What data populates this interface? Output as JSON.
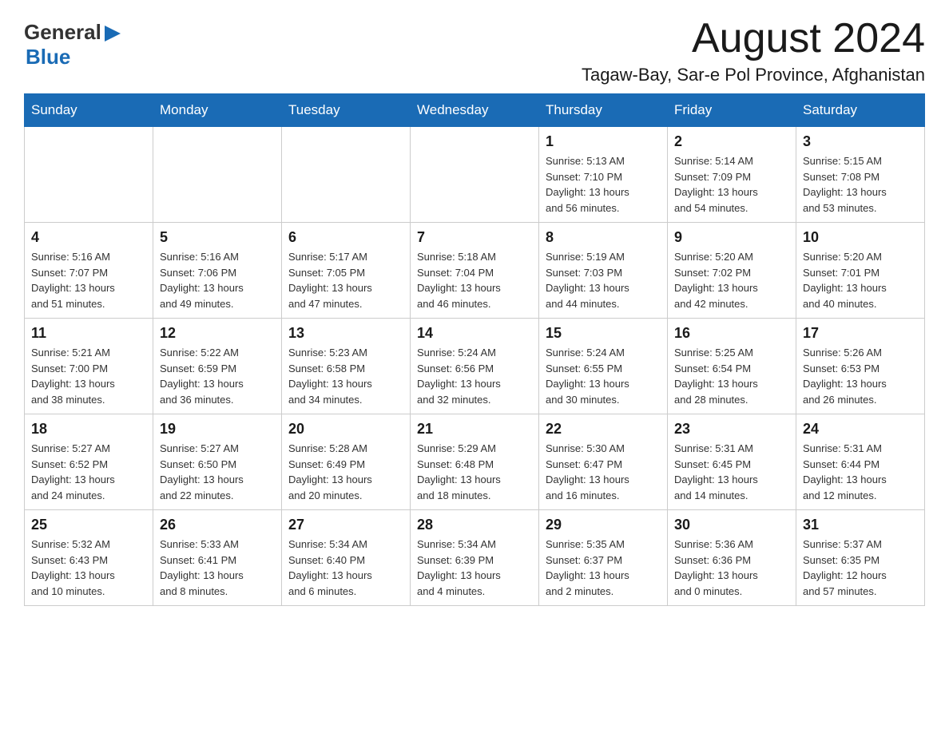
{
  "header": {
    "logo": {
      "general": "General",
      "blue": "Blue",
      "arrow_unicode": "▶"
    },
    "month_title": "August 2024",
    "location": "Tagaw-Bay, Sar-e Pol Province, Afghanistan"
  },
  "calendar": {
    "headers": [
      "Sunday",
      "Monday",
      "Tuesday",
      "Wednesday",
      "Thursday",
      "Friday",
      "Saturday"
    ],
    "weeks": [
      [
        {
          "day": "",
          "info": ""
        },
        {
          "day": "",
          "info": ""
        },
        {
          "day": "",
          "info": ""
        },
        {
          "day": "",
          "info": ""
        },
        {
          "day": "1",
          "info": "Sunrise: 5:13 AM\nSunset: 7:10 PM\nDaylight: 13 hours\nand 56 minutes."
        },
        {
          "day": "2",
          "info": "Sunrise: 5:14 AM\nSunset: 7:09 PM\nDaylight: 13 hours\nand 54 minutes."
        },
        {
          "day": "3",
          "info": "Sunrise: 5:15 AM\nSunset: 7:08 PM\nDaylight: 13 hours\nand 53 minutes."
        }
      ],
      [
        {
          "day": "4",
          "info": "Sunrise: 5:16 AM\nSunset: 7:07 PM\nDaylight: 13 hours\nand 51 minutes."
        },
        {
          "day": "5",
          "info": "Sunrise: 5:16 AM\nSunset: 7:06 PM\nDaylight: 13 hours\nand 49 minutes."
        },
        {
          "day": "6",
          "info": "Sunrise: 5:17 AM\nSunset: 7:05 PM\nDaylight: 13 hours\nand 47 minutes."
        },
        {
          "day": "7",
          "info": "Sunrise: 5:18 AM\nSunset: 7:04 PM\nDaylight: 13 hours\nand 46 minutes."
        },
        {
          "day": "8",
          "info": "Sunrise: 5:19 AM\nSunset: 7:03 PM\nDaylight: 13 hours\nand 44 minutes."
        },
        {
          "day": "9",
          "info": "Sunrise: 5:20 AM\nSunset: 7:02 PM\nDaylight: 13 hours\nand 42 minutes."
        },
        {
          "day": "10",
          "info": "Sunrise: 5:20 AM\nSunset: 7:01 PM\nDaylight: 13 hours\nand 40 minutes."
        }
      ],
      [
        {
          "day": "11",
          "info": "Sunrise: 5:21 AM\nSunset: 7:00 PM\nDaylight: 13 hours\nand 38 minutes."
        },
        {
          "day": "12",
          "info": "Sunrise: 5:22 AM\nSunset: 6:59 PM\nDaylight: 13 hours\nand 36 minutes."
        },
        {
          "day": "13",
          "info": "Sunrise: 5:23 AM\nSunset: 6:58 PM\nDaylight: 13 hours\nand 34 minutes."
        },
        {
          "day": "14",
          "info": "Sunrise: 5:24 AM\nSunset: 6:56 PM\nDaylight: 13 hours\nand 32 minutes."
        },
        {
          "day": "15",
          "info": "Sunrise: 5:24 AM\nSunset: 6:55 PM\nDaylight: 13 hours\nand 30 minutes."
        },
        {
          "day": "16",
          "info": "Sunrise: 5:25 AM\nSunset: 6:54 PM\nDaylight: 13 hours\nand 28 minutes."
        },
        {
          "day": "17",
          "info": "Sunrise: 5:26 AM\nSunset: 6:53 PM\nDaylight: 13 hours\nand 26 minutes."
        }
      ],
      [
        {
          "day": "18",
          "info": "Sunrise: 5:27 AM\nSunset: 6:52 PM\nDaylight: 13 hours\nand 24 minutes."
        },
        {
          "day": "19",
          "info": "Sunrise: 5:27 AM\nSunset: 6:50 PM\nDaylight: 13 hours\nand 22 minutes."
        },
        {
          "day": "20",
          "info": "Sunrise: 5:28 AM\nSunset: 6:49 PM\nDaylight: 13 hours\nand 20 minutes."
        },
        {
          "day": "21",
          "info": "Sunrise: 5:29 AM\nSunset: 6:48 PM\nDaylight: 13 hours\nand 18 minutes."
        },
        {
          "day": "22",
          "info": "Sunrise: 5:30 AM\nSunset: 6:47 PM\nDaylight: 13 hours\nand 16 minutes."
        },
        {
          "day": "23",
          "info": "Sunrise: 5:31 AM\nSunset: 6:45 PM\nDaylight: 13 hours\nand 14 minutes."
        },
        {
          "day": "24",
          "info": "Sunrise: 5:31 AM\nSunset: 6:44 PM\nDaylight: 13 hours\nand 12 minutes."
        }
      ],
      [
        {
          "day": "25",
          "info": "Sunrise: 5:32 AM\nSunset: 6:43 PM\nDaylight: 13 hours\nand 10 minutes."
        },
        {
          "day": "26",
          "info": "Sunrise: 5:33 AM\nSunset: 6:41 PM\nDaylight: 13 hours\nand 8 minutes."
        },
        {
          "day": "27",
          "info": "Sunrise: 5:34 AM\nSunset: 6:40 PM\nDaylight: 13 hours\nand 6 minutes."
        },
        {
          "day": "28",
          "info": "Sunrise: 5:34 AM\nSunset: 6:39 PM\nDaylight: 13 hours\nand 4 minutes."
        },
        {
          "day": "29",
          "info": "Sunrise: 5:35 AM\nSunset: 6:37 PM\nDaylight: 13 hours\nand 2 minutes."
        },
        {
          "day": "30",
          "info": "Sunrise: 5:36 AM\nSunset: 6:36 PM\nDaylight: 13 hours\nand 0 minutes."
        },
        {
          "day": "31",
          "info": "Sunrise: 5:37 AM\nSunset: 6:35 PM\nDaylight: 12 hours\nand 57 minutes."
        }
      ]
    ]
  }
}
